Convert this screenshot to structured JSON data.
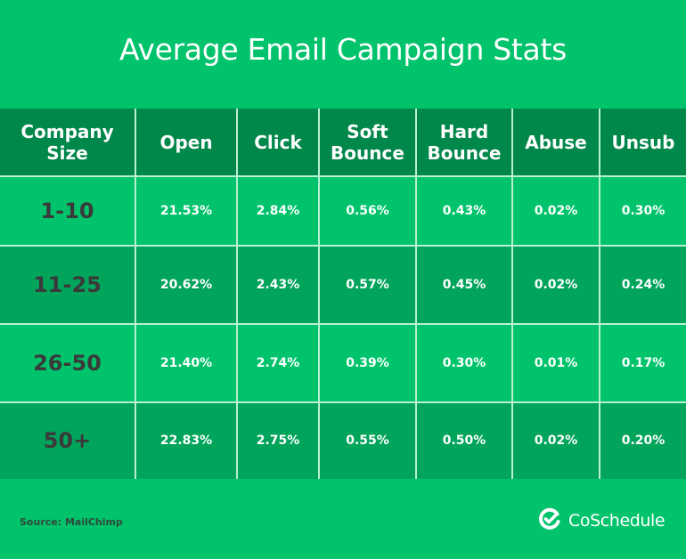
{
  "title": "Average Email Campaign Stats",
  "colors": {
    "background": "#00c36b",
    "header": "#00874a",
    "row_light": "#00c36b",
    "row_dark": "#00a45b",
    "grid_line": "#b9f0d2",
    "size_text": "#3a3a3a",
    "value_text": "#ffffff"
  },
  "table": {
    "headers": [
      "Company\nSize",
      "Open",
      "Click",
      "Soft\nBounce",
      "Hard\nBounce",
      "Abuse",
      "Unsub"
    ],
    "header_lines": [
      [
        "Company",
        "Size"
      ],
      [
        "Open"
      ],
      [
        "Click"
      ],
      [
        "Soft",
        "Bounce"
      ],
      [
        "Hard",
        "Bounce"
      ],
      [
        "Abuse"
      ],
      [
        "Unsub"
      ]
    ],
    "rows": [
      [
        "1-10",
        "21.53%",
        "2.84%",
        "0.56%",
        "0.43%",
        "0.02%",
        "0.30%"
      ],
      [
        "11-25",
        "20.62%",
        "2.43%",
        "0.57%",
        "0.45%",
        "0.02%",
        "0.24%"
      ],
      [
        "26-50",
        "21.40%",
        "2.74%",
        "0.39%",
        "0.30%",
        "0.01%",
        "0.17%"
      ],
      [
        "50+",
        "22.83%",
        "2.75%",
        "0.55%",
        "0.50%",
        "0.02%",
        "0.20%"
      ]
    ]
  },
  "footer": {
    "source": "Source: MailChimp",
    "logo_text": "CoSchedule",
    "logo_icon": "check-circle-icon"
  },
  "chart_data": {
    "type": "table",
    "title": "Average Email Campaign Stats",
    "columns": [
      "Company Size",
      "Open",
      "Click",
      "Soft Bounce",
      "Hard Bounce",
      "Abuse",
      "Unsub"
    ],
    "categories": [
      "1-10",
      "11-25",
      "26-50",
      "50+"
    ],
    "series": [
      {
        "name": "Open",
        "values": [
          21.53,
          20.62,
          21.4,
          22.83
        ],
        "unit": "%"
      },
      {
        "name": "Click",
        "values": [
          2.84,
          2.43,
          2.74,
          2.75
        ],
        "unit": "%"
      },
      {
        "name": "Soft Bounce",
        "values": [
          0.56,
          0.57,
          0.39,
          0.55
        ],
        "unit": "%"
      },
      {
        "name": "Hard Bounce",
        "values": [
          0.43,
          0.45,
          0.3,
          0.5
        ],
        "unit": "%"
      },
      {
        "name": "Abuse",
        "values": [
          0.02,
          0.02,
          0.01,
          0.02
        ],
        "unit": "%"
      },
      {
        "name": "Unsub",
        "values": [
          0.3,
          0.24,
          0.17,
          0.2
        ],
        "unit": "%"
      }
    ],
    "source": "Source: MailChimp"
  }
}
